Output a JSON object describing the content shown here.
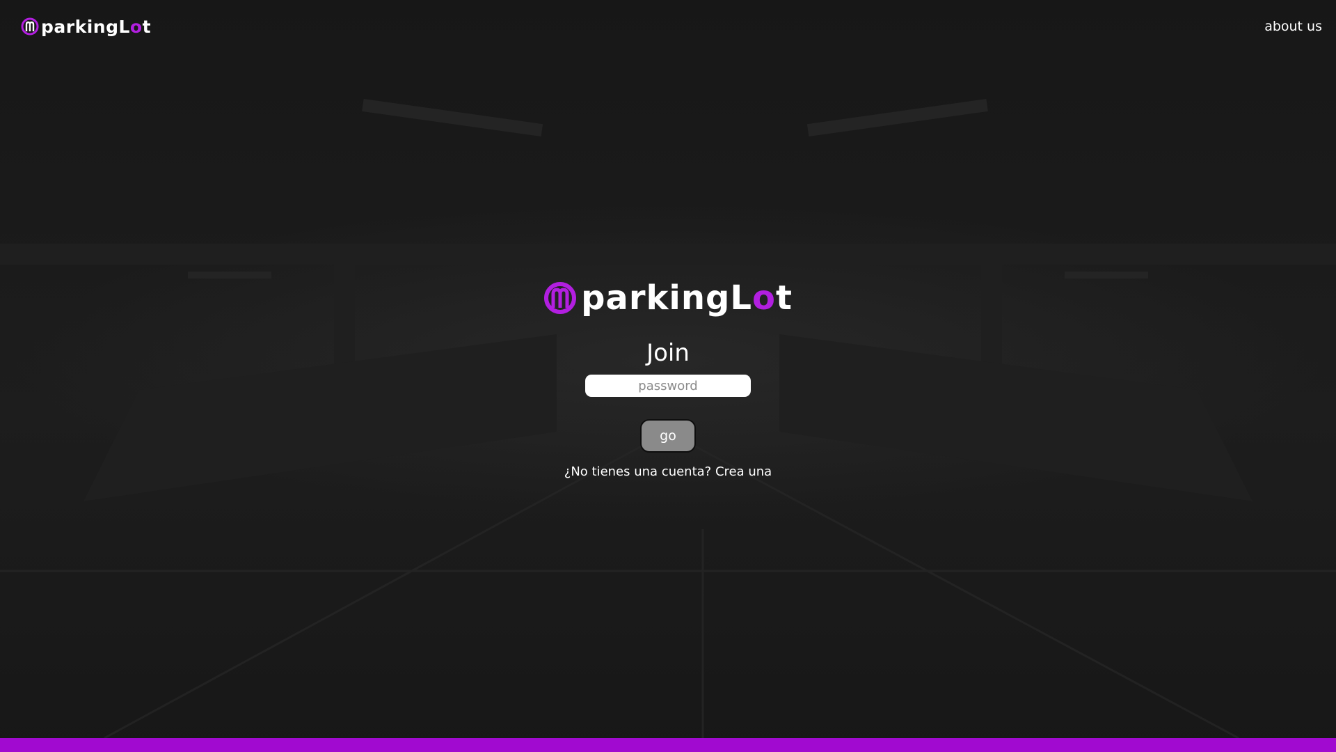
{
  "header": {
    "logo": {
      "prefix": "parking",
      "suffix_l": "L",
      "suffix_o": "o",
      "suffix_t": "t"
    },
    "about_label": "about us"
  },
  "login": {
    "logo": {
      "prefix": "parking",
      "suffix_l": "L",
      "suffix_o": "o",
      "suffix_t": "t"
    },
    "title": "Join",
    "password_placeholder": "password",
    "password_value": "",
    "submit_label": "go",
    "signup_prompt": "¿No tienes una cuenta?",
    "signup_link": "Crea una"
  },
  "colors": {
    "background": "#181818",
    "accent": "#a10ad0",
    "logo_accent": "#b21fe0",
    "button_bg": "#8a8a8a"
  },
  "icons": {
    "brand_mark": "mp-monogram-icon"
  }
}
